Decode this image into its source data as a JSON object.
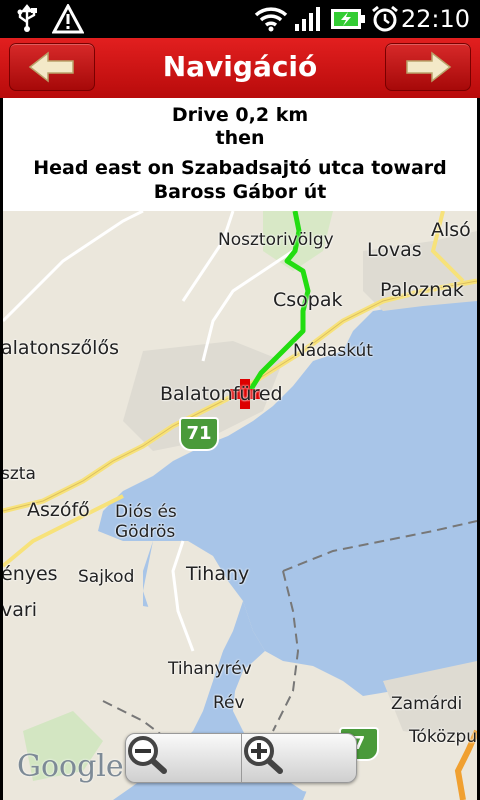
{
  "status_bar": {
    "time": "22:10",
    "icons": [
      "usb-icon",
      "warning-icon",
      "wifi-icon",
      "signal-icon",
      "battery-charging-icon",
      "alarm-icon"
    ]
  },
  "title_bar": {
    "title": "Navigáció",
    "back_icon": "arrow-left-icon",
    "forward_icon": "arrow-right-icon"
  },
  "instruction": {
    "distance": "Drive 0,2 km then",
    "direction": "Head east on Szabadsajtó utca toward Baross Gábor út"
  },
  "map": {
    "labels": {
      "nosztorivolgy": "Nosztorivölgy",
      "also": "Alsó",
      "lovas": "Lovas",
      "csopak": "Csopak",
      "paloznak": "Paloznak",
      "balatonszolos": "alatonszőlős",
      "nadaskut": "Nádaskút",
      "balatonfured": "Balatonfüred",
      "szta": "szta",
      "aszofo": "Aszófő",
      "dios": "Diós és",
      "godros": "Gödrös",
      "enyes": "ényes",
      "sajkod": "Sajkod",
      "tihany": "Tihany",
      "vari": "vari",
      "tihanyrev": "Tihanyrév",
      "rev": "Rév",
      "zamardi": "Zamárdi",
      "tokozpu": "Tóközpu"
    },
    "road_shield_1": "71",
    "road_shield_2": "7",
    "attribution": "Google",
    "route_color": "#22dd11",
    "marker_color": "#dd0000"
  },
  "zoom": {
    "out_icon": "zoom-out-icon",
    "in_icon": "zoom-in-icon"
  }
}
